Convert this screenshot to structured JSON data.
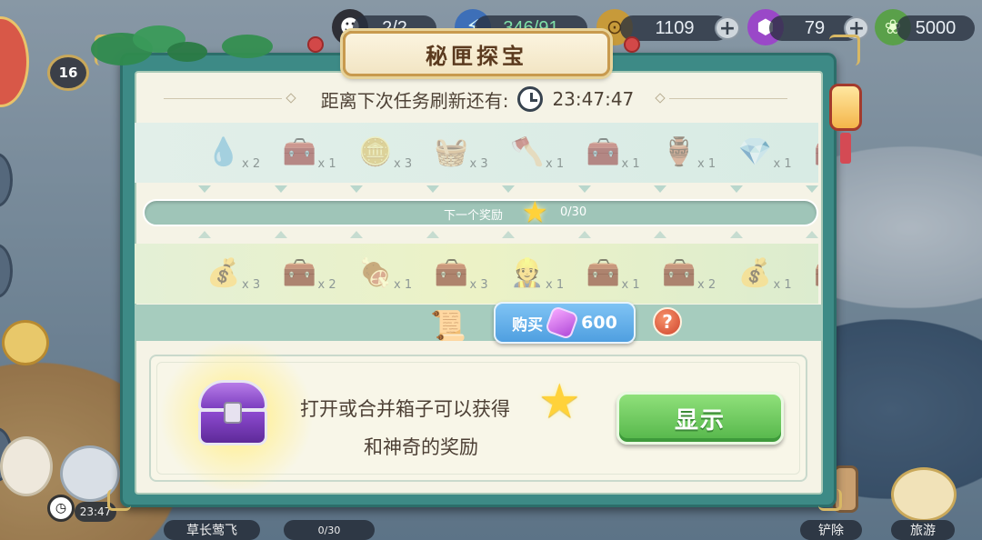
{
  "hud": {
    "hero_count": "2/2",
    "energy": "346/91",
    "coins": "1109",
    "gems": "79",
    "leaf_currency": "5000",
    "level": "16"
  },
  "panel": {
    "title": "秘匣探宝",
    "timer_label": "距离下次任务刷新还有:",
    "timer_value": "23:47:47",
    "progress_label": "下一个奖励",
    "progress_value": "0/30",
    "progress_fraction": 0.0,
    "buy_label": "购买",
    "buy_price": "600",
    "help_label": "?",
    "info_line1": "打开或合并箱子可以获得",
    "info_line2": "和神奇的奖励",
    "show_button": "显示"
  },
  "top_rewards": [
    {
      "icon": "drop-icon",
      "glyph": "💧",
      "count": "x 2"
    },
    {
      "icon": "chest-icon",
      "glyph": "🧰",
      "count": "x 1"
    },
    {
      "icon": "coin-pile-icon",
      "glyph": "🪙",
      "count": "x 3"
    },
    {
      "icon": "basket-icon",
      "glyph": "🧺",
      "count": "x 3"
    },
    {
      "icon": "axe-icon",
      "glyph": "🪓",
      "count": "x 1"
    },
    {
      "icon": "chest-icon",
      "glyph": "🧰",
      "count": "x 1"
    },
    {
      "icon": "pot-icon",
      "glyph": "🏺",
      "count": "x 1"
    },
    {
      "icon": "gem-basket-icon",
      "glyph": "💎",
      "count": "x 1"
    }
  ],
  "bottom_rewards": [
    {
      "icon": "bag-icon",
      "glyph": "💰",
      "count": "x 3"
    },
    {
      "icon": "chest-icon",
      "glyph": "🧰",
      "count": "x 2"
    },
    {
      "icon": "meat-icon",
      "glyph": "🍖",
      "count": "x 1"
    },
    {
      "icon": "chest-icon",
      "glyph": "🧰",
      "count": "x 3"
    },
    {
      "icon": "worker-icon",
      "glyph": "👷",
      "count": "x 1"
    },
    {
      "icon": "chest-icon",
      "glyph": "🧰",
      "count": "x 1"
    },
    {
      "icon": "green-chest-icon",
      "glyph": "🧰",
      "count": "x 2"
    },
    {
      "icon": "bag-icon",
      "glyph": "💰",
      "count": "x 1"
    }
  ],
  "bottom_bar": {
    "timer": "23:47",
    "kite_label": "草长莺飞",
    "progress": "0/30",
    "remove_label": "铲除",
    "travel_label": "旅游"
  },
  "colors": {
    "panel_frame": "#3d8a86",
    "panel_bg": "#f5f3e6",
    "buy_button": "#4f9fe0",
    "show_button": "#55b64a",
    "help_button": "#d7553a"
  }
}
